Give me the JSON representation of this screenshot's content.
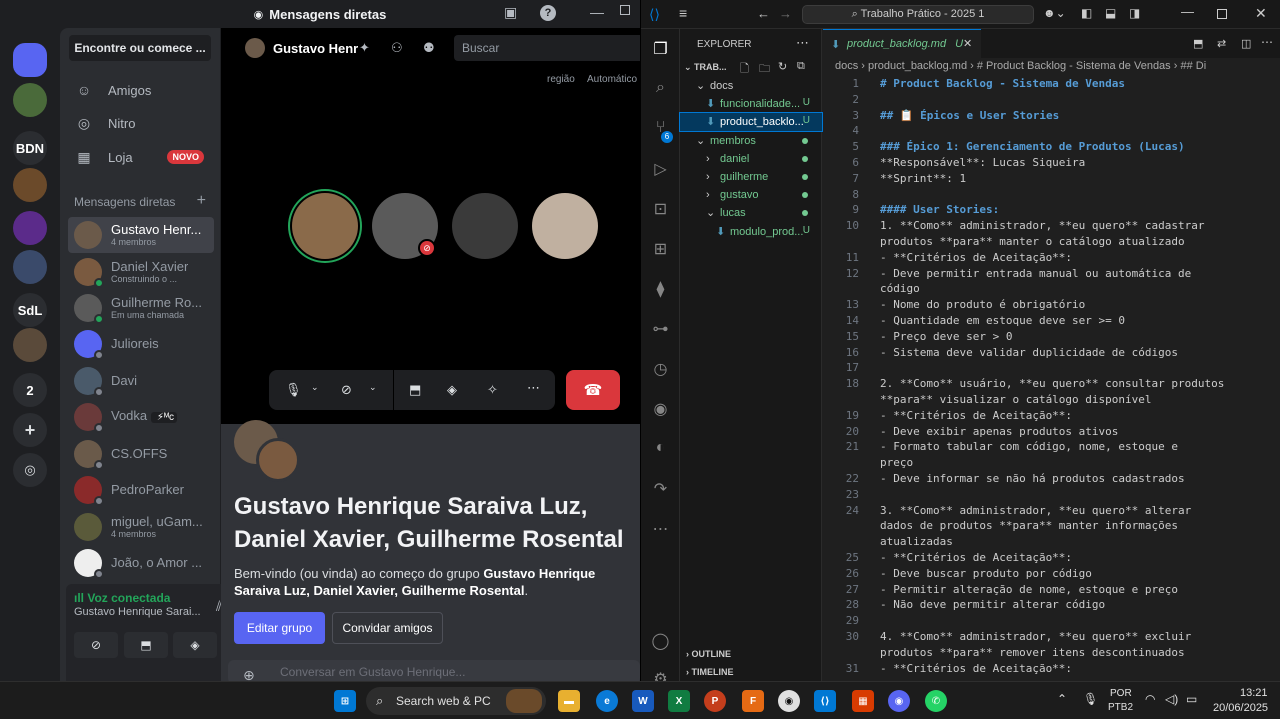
{
  "discord": {
    "window_title": "Mensagens diretas",
    "servers": [
      {
        "label": "",
        "color": "#5865f2",
        "icon": "discord-logo-icon"
      },
      {
        "label": "",
        "color": "#4a6a3a",
        "icon": "avatar-icon"
      },
      {
        "label": "BDN",
        "color": "#2b2d31",
        "icon": ""
      },
      {
        "label": "",
        "color": "#6b4a2a",
        "icon": "server-image-icon"
      },
      {
        "label": "",
        "color": "#5b2b8a",
        "icon": "server-image-icon"
      },
      {
        "label": "",
        "color": "#3a4a6a",
        "icon": "server-image-icon"
      },
      {
        "label": "SdL",
        "color": "#2b2d31",
        "icon": ""
      },
      {
        "label": "",
        "color": "#5a4a3a",
        "icon": "server-image-icon"
      },
      {
        "label": "2",
        "color": "#2b2d31",
        "icon": ""
      }
    ],
    "find_label": "Encontre ou comece ...",
    "nav": {
      "friends": "Amigos",
      "nitro": "Nitro",
      "shop": "Loja",
      "new_badge": "NOVO"
    },
    "dm_header": "Mensagens diretas",
    "dms": [
      {
        "name": "Gustavo Henr...",
        "sub": "4 membros",
        "color": "#6b5a4a",
        "status": "",
        "selected": true
      },
      {
        "name": "Daniel Xavier",
        "sub": "Construindo o ...",
        "color": "#7a5a40",
        "status": "on"
      },
      {
        "name": "Guilherme Ro...",
        "sub": "Em uma chamada",
        "color": "#5a5a5a",
        "status": "on"
      },
      {
        "name": "Julioreis",
        "sub": "",
        "color": "#5865f2",
        "status": "off"
      },
      {
        "name": "Davi",
        "sub": "",
        "color": "#4a5a6a",
        "status": "off"
      },
      {
        "name": "Vodka",
        "sub": "",
        "color": "#6a3a3a",
        "status": "off",
        "tag": "⚡ᴹᴄ"
      },
      {
        "name": "CS.OFFS",
        "sub": "",
        "color": "#6a5a4a",
        "status": "off"
      },
      {
        "name": "PedroParker",
        "sub": "",
        "color": "#8a2a2a",
        "status": "off"
      },
      {
        "name": "miguel, uGam...",
        "sub": "4 membros",
        "color": "#5a5a3a",
        "status": ""
      },
      {
        "name": "João, o Amor ...",
        "sub": "",
        "color": "#eeeeee",
        "status": "off"
      }
    ],
    "voice": {
      "title": "Voz conectada",
      "channel": "Gustavo Henrique Sarai..."
    },
    "call": {
      "name": "Gustavo Henr",
      "search_placeholder": "Buscar",
      "region_label": "região",
      "region_value": "Automático",
      "participants": [
        {
          "color": "#8a6a4a",
          "speaking": true
        },
        {
          "color": "#5a5a5a",
          "muted": true
        },
        {
          "color": "#3a3a3a"
        },
        {
          "color": "#c0b0a0"
        }
      ]
    },
    "chat": {
      "group_title": "Gustavo Henrique Saraiva Luz, Daniel Xavier, Guilherme Rosental",
      "welcome_prefix": "Bem-vindo (ou vinda) ao começo do grupo ",
      "welcome_group": "Gustavo Henrique Saraiva Luz, Daniel Xavier, Guilherme Rosental",
      "welcome_suffix": ".",
      "edit_label": "Editar grupo",
      "invite_label": "Convidar amigos",
      "input_placeholder": "Conversar em Gustavo Henrique..."
    }
  },
  "vscode": {
    "search": "Trabalho Prático - 2025 1",
    "explorer_title": "EXPLORER",
    "workspace": "TRAB...",
    "tree": [
      {
        "label": "docs",
        "indent": 1,
        "type": "folder-open"
      },
      {
        "label": "funcionalidade...",
        "indent": 2,
        "type": "file",
        "badge": "U"
      },
      {
        "label": "product_backlo...",
        "indent": 2,
        "type": "file",
        "badge": "U",
        "selected": true
      },
      {
        "label": "membros",
        "indent": 1,
        "type": "folder-open",
        "dot": true
      },
      {
        "label": "daniel",
        "indent": 2,
        "type": "folder",
        "dot": true
      },
      {
        "label": "guilherme",
        "indent": 2,
        "type": "folder",
        "dot": true
      },
      {
        "label": "gustavo",
        "indent": 2,
        "type": "folder",
        "dot": true
      },
      {
        "label": "lucas",
        "indent": 2,
        "type": "folder-open",
        "dot": true
      },
      {
        "label": "modulo_prod...",
        "indent": 3,
        "type": "file",
        "badge": "U"
      }
    ],
    "outline": "OUTLINE",
    "timeline": "TIMELINE",
    "scm_count": "6",
    "tab": {
      "name": "product_backlog.md",
      "badge": "U"
    },
    "breadcrumb": "docs  ›  product_backlog.md  ›  # Product Backlog - Sistema de Vendas  ›  ## Di",
    "lines": [
      {
        "n": "1",
        "t": "# Product Backlog - Sistema de Vendas",
        "c": "h"
      },
      {
        "n": "2",
        "t": ""
      },
      {
        "n": "3",
        "t": "## 📋 Épicos e User Stories",
        "c": "h"
      },
      {
        "n": "4",
        "t": ""
      },
      {
        "n": "5",
        "t": "### Épico 1: Gerenciamento de Produtos (Lucas)",
        "c": "h"
      },
      {
        "n": "6",
        "t": "**Responsável**: Lucas Siqueira",
        "c": "bk"
      },
      {
        "n": "7",
        "t": "**Sprint**: 1",
        "c": "bk"
      },
      {
        "n": "8",
        "t": ""
      },
      {
        "n": "9",
        "t": "#### User Stories:",
        "c": "h"
      },
      {
        "n": "10",
        "t": "1. **Como** administrador, **eu quero** cadastrar",
        "c": "bk"
      },
      {
        "n": "",
        "t": "produtos **para** manter o catálogo atualizado",
        "c": "bk"
      },
      {
        "n": "11",
        "t": "   - **Critérios de Aceitação**:",
        "c": "bk"
      },
      {
        "n": "12",
        "t": "     - Deve permitir entrada manual ou automática de"
      },
      {
        "n": "",
        "t": "     código"
      },
      {
        "n": "13",
        "t": "     - Nome do produto é obrigatório"
      },
      {
        "n": "14",
        "t": "     - Quantidade em estoque deve ser >= 0"
      },
      {
        "n": "15",
        "t": "     - Preço deve ser > 0"
      },
      {
        "n": "16",
        "t": "     - Sistema deve validar duplicidade de códigos"
      },
      {
        "n": "17",
        "t": ""
      },
      {
        "n": "18",
        "t": "2. **Como** usuário, **eu quero** consultar produtos",
        "c": "bk"
      },
      {
        "n": "",
        "t": "**para** visualizar o catálogo disponível",
        "c": "bk"
      },
      {
        "n": "19",
        "t": "   - **Critérios de Aceitação**:",
        "c": "bk"
      },
      {
        "n": "20",
        "t": "     - Deve exibir apenas produtos ativos"
      },
      {
        "n": "21",
        "t": "     - Formato tabular com código, nome, estoque e"
      },
      {
        "n": "",
        "t": "     preço"
      },
      {
        "n": "22",
        "t": "     - Deve informar se não há produtos cadastrados"
      },
      {
        "n": "23",
        "t": ""
      },
      {
        "n": "24",
        "t": "3. **Como** administrador, **eu quero** alterar",
        "c": "bk"
      },
      {
        "n": "",
        "t": "dados de produtos **para** manter informações",
        "c": "bk"
      },
      {
        "n": "",
        "t": "atualizadas"
      },
      {
        "n": "25",
        "t": "   - **Critérios de Aceitação**:",
        "c": "bk"
      },
      {
        "n": "26",
        "t": "     - Deve buscar produto por código"
      },
      {
        "n": "27",
        "t": "     - Permitir alteração de nome, estoque e preço"
      },
      {
        "n": "28",
        "t": "     - Não deve permitir alterar código"
      },
      {
        "n": "29",
        "t": ""
      },
      {
        "n": "30",
        "t": "4. **Como** administrador, **eu quero** excluir",
        "c": "bk"
      },
      {
        "n": "",
        "t": "produtos **para** remover itens descontinuados",
        "c": "bk"
      },
      {
        "n": "31",
        "t": "   - **Critérios de Aceitação**:",
        "c": "bk"
      }
    ]
  },
  "taskbar": {
    "search": "Search web & PC",
    "lang": "POR",
    "layout": "PTB2",
    "time": "13:21",
    "date": "20/06/2025"
  }
}
